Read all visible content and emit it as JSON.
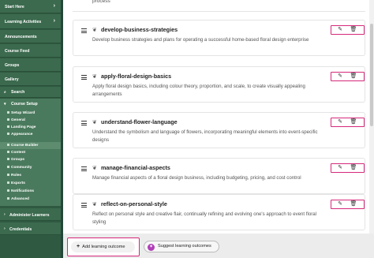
{
  "sidebar": {
    "top_items": [
      {
        "label": "Start Here",
        "chevron": "›"
      },
      {
        "label": "Learning Activities",
        "chevron": "›"
      },
      {
        "label": "Announcements"
      },
      {
        "label": "Course Feed"
      },
      {
        "label": "Groups"
      },
      {
        "label": "Gallery"
      },
      {
        "label": "Search"
      }
    ],
    "course_setup": {
      "label": "Course Setup",
      "items": [
        "Setup Wizard",
        "General",
        "Landing Page",
        "Appearance",
        "Course Builder",
        "Content",
        "Groups",
        "Community",
        "Roles",
        "Exports",
        "Notifications",
        "Advanced"
      ],
      "active": "Course Builder"
    },
    "bottom_items": [
      {
        "label": "Administer Learners"
      },
      {
        "label": "Credentials"
      }
    ]
  },
  "main": {
    "prev_text": "process",
    "outcomes": [
      {
        "title": "develop-business-strategies",
        "description": "Develop business strategies and plans for operating a successful home-based floral design enterprise"
      },
      {
        "title": "apply-floral-design-basics",
        "description": "Apply floral design basics, including colour theory, proportion, and scale, to create visually appealing arrangements"
      },
      {
        "title": "understand-flower-language",
        "description": "Understand the symbolism and language of flowers, incorporating meaningful elements into event-specific designs"
      },
      {
        "title": "manage-financial-aspects",
        "description": "Manage financial aspects of a floral design business, including budgeting, pricing, and cost control"
      },
      {
        "title": "reflect-on-personal-style",
        "description": "Reflect on personal style and creative flair, continually refining and evolving one's approach to event floral styling"
      }
    ],
    "icons": {
      "edit": "edit-icon",
      "delete": "trash-icon",
      "drag": "drag-handle-icon",
      "outcome": "outcome-icon"
    },
    "accent": "#d6287a"
  },
  "footer": {
    "add_label": "Add learning outcome",
    "add_symbol": "+",
    "suggest_label": "Suggest learning outcomes"
  }
}
